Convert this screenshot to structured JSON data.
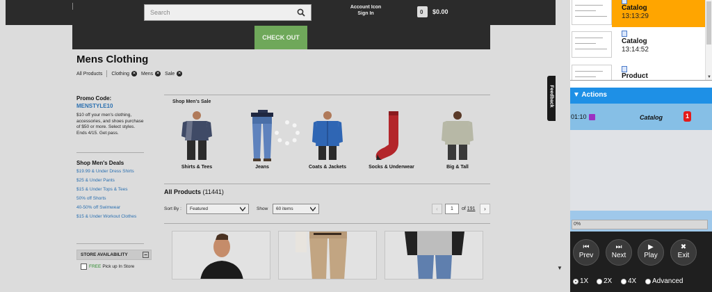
{
  "header": {
    "search_placeholder": "Search",
    "account_icon_label": "Account Icon",
    "sign_in": "Sign In",
    "cart_count": "0",
    "cart_total": "$0.00",
    "checkout": "CHECK OUT"
  },
  "page": {
    "title": "Mens Clothing",
    "breadcrumbs": [
      {
        "label": "All Products",
        "removable": false
      },
      {
        "label": "Clothing",
        "removable": true
      },
      {
        "label": "Mens",
        "removable": true
      },
      {
        "label": "Sale",
        "removable": true
      }
    ]
  },
  "promo": {
    "title": "Promo Code:",
    "code": "MENSTYLE10",
    "text": "$10 off your men's clothing, accessories, and shoes purchase of $50 or more. Select styles. Ends 4/15. Get pass."
  },
  "deals": {
    "title": "Shop Men's Deals",
    "items": [
      "$19.99 & Under Dress Shirts",
      "$25 & Under Pants",
      "$15 & Under Tops & Tees",
      "50% off Shorts",
      "40-50% off Swimwear",
      "$15 & Under Workout Clothes"
    ]
  },
  "store_availability": {
    "title": "STORE AVAILABILITY",
    "toggle": "−",
    "free": "FREE",
    "pickup": "Pick up In Store"
  },
  "sale": {
    "title": "Shop Men's Sale",
    "categories": [
      "Shirts & Tees",
      "Jeans",
      "Coats & Jackets",
      "Socks & Underwear",
      "Big & Tall"
    ]
  },
  "listing": {
    "title": "All Products",
    "count": "(11441)",
    "sort_label": "Sort By :",
    "sort_value": "Featured",
    "show_label": "Show",
    "show_value": "60 items",
    "page_prev": "‹",
    "page_current": "1",
    "page_of": "of",
    "page_total": "191",
    "page_next": "›"
  },
  "feedback": "Feedback",
  "panel": {
    "thumbnails": [
      {
        "title": "Catalog",
        "time": "13:13:29",
        "active": true
      },
      {
        "title": "Catalog",
        "time": "13:14:52",
        "active": false
      },
      {
        "title": "Product",
        "time": "",
        "active": false
      }
    ],
    "actions_title": "Actions",
    "action": {
      "time": "01:10",
      "name": "Catalog",
      "count": "1"
    },
    "progress": 0,
    "progress_label": "0%",
    "controls": {
      "prev": "Prev",
      "next": "Next",
      "play": "Play",
      "exit": "Exit"
    },
    "speeds": [
      {
        "label": "1X",
        "selected": true
      },
      {
        "label": "2X",
        "selected": false
      },
      {
        "label": "4X",
        "selected": false
      },
      {
        "label": "Advanced",
        "selected": false
      }
    ]
  }
}
